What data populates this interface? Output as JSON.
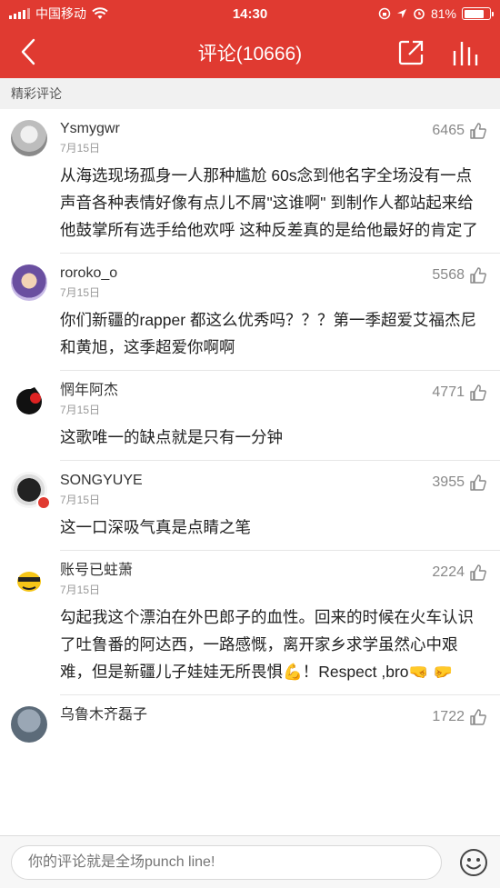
{
  "status_bar": {
    "carrier": "中国移动",
    "time": "14:30",
    "battery": "81%",
    "battery_level": 0.81
  },
  "navbar": {
    "title": "评论(10666)",
    "icons": [
      "back-icon",
      "share-icon",
      "stats-icon"
    ]
  },
  "section": {
    "label": "精彩评论"
  },
  "comments": [
    {
      "user": "Ysmygwr",
      "date": "7月15日",
      "likes": "6465",
      "text": "从海选现场孤身一人那种尴尬 60s念到他名字全场没有一点声音各种表情好像有点儿不屑\"这谁啊\" 到制作人都站起来给他鼓掌所有选手给他欢呼 这种反差真的是给他最好的肯定了"
    },
    {
      "user": "roroko_o",
      "date": "7月15日",
      "likes": "5568",
      "text": "你们新疆的rapper 都这么优秀吗？？？第一季超爱艾福杰尼和黄旭，这季超爱你啊啊"
    },
    {
      "user": "惘年阿杰",
      "date": "7月15日",
      "likes": "4771",
      "text": "这歌唯一的缺点就是只有一分钟"
    },
    {
      "user": "SONGYUYE",
      "date": "7月15日",
      "likes": "3955",
      "text": "这一口深吸气真是点睛之笔"
    },
    {
      "user": "账号已蛀萧",
      "date": "7月15日",
      "likes": "2224",
      "text": "勾起我这个漂泊在外巴郎子的血性。回来的时候在火车认识了吐鲁番的阿达西，一路感慨，离开家乡求学虽然心中艰难，但是新疆儿子娃娃无所畏惧💪！Respect ,bro🤜 🤛"
    },
    {
      "user": "乌鲁木齐磊子",
      "date": "",
      "likes": "1722",
      "text": ""
    }
  ],
  "bottom_bar": {
    "placeholder": "你的评论就是全场punch line!",
    "emoji_icon": "smiley-icon"
  },
  "colors": {
    "brand_red": "#e03a31",
    "section_bg": "#f1f1f1"
  }
}
